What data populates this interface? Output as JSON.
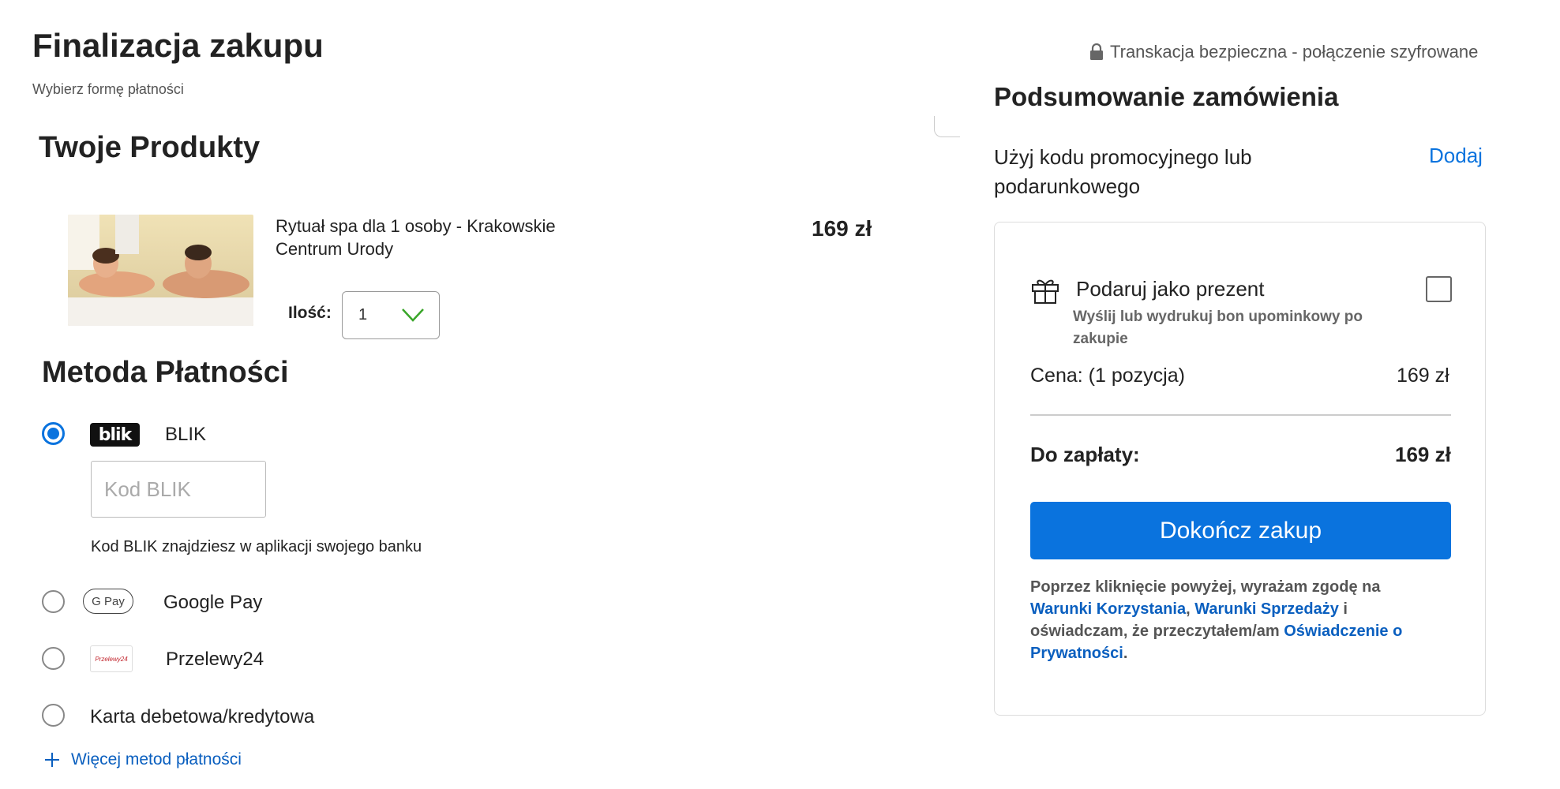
{
  "header": {
    "title": "Finalizacja zakupu",
    "subtitle": "Wybierz formę płatności",
    "secure_note": "Transkacja bezpieczna - połączenie szyfrowane"
  },
  "products": {
    "title": "Twoje Produkty",
    "items": [
      {
        "name": "Rytuał spa dla 1 osoby - Krakowskie Centrum Urody",
        "price": "169 zł",
        "quantity_label": "Ilość:",
        "quantity": "1"
      }
    ]
  },
  "payment": {
    "title": "Metoda Płatności",
    "methods": [
      {
        "label": "BLIK",
        "selected": true,
        "logo_text": "blik"
      },
      {
        "label": "Google Pay",
        "selected": false,
        "logo_text": "G Pay"
      },
      {
        "label": "Przelewy24",
        "selected": false,
        "logo_text": "Przelewy24"
      },
      {
        "label": "Karta debetowa/kredytowa",
        "selected": false
      }
    ],
    "blik_placeholder": "Kod BLIK",
    "blik_hint": "Kod BLIK znajdziesz w aplikacji swojego banku",
    "more_methods": "Więcej metod płatności"
  },
  "summary": {
    "title": "Podsumowanie zamówienia",
    "promo_text": "Użyj kodu promocyjnego lub podarunkowego",
    "promo_add": "Dodaj",
    "gift_title": "Podaruj jako prezent",
    "gift_desc": "Wyślij lub wydrukuj bon upominkowy po zakupie",
    "gift_checked": false,
    "price_label": "Cena: (1 pozycja)",
    "price_value": "169 zł",
    "total_label": "Do zapłaty:",
    "total_value": "169 zł",
    "checkout_button": "Dokończ zakup",
    "terms": {
      "part1": "Poprzez kliknięcie powyżej, wyrażam zgodę na ",
      "link1": "Warunki Korzystania",
      "sep1": ", ",
      "link2": "Warunki Sprzedaży",
      "part2": " i oświadczam, że przeczytałem/am ",
      "link3": "Oświadczenie o Prywatności",
      "part3": "."
    }
  },
  "colors": {
    "accent": "#0a73de",
    "link": "#0a5fbf",
    "qty_chevron": "#3aa62a"
  }
}
